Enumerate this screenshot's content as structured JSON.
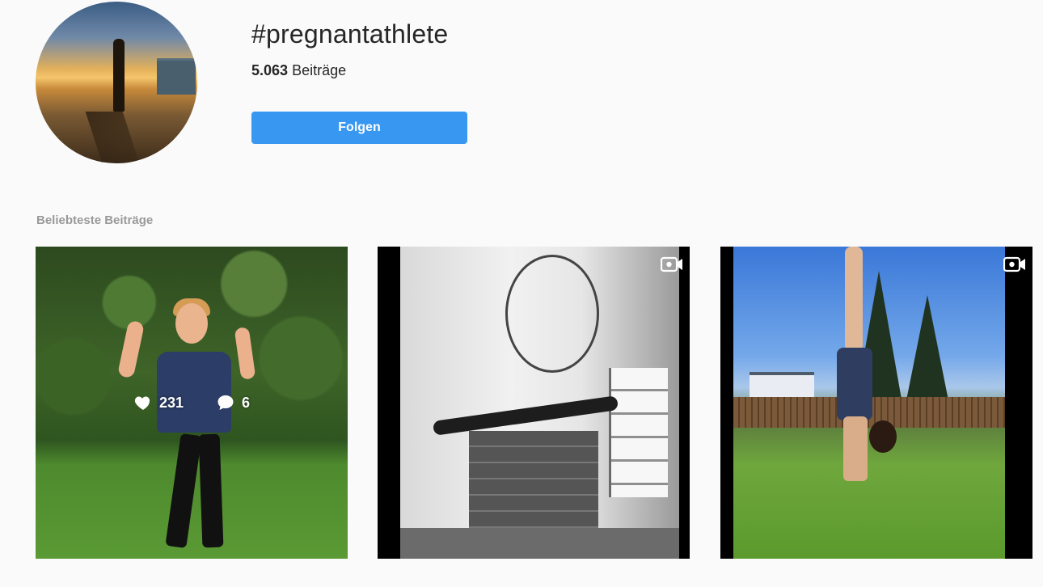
{
  "header": {
    "hashtag": "#pregnantathlete",
    "post_count_number": "5.063",
    "post_count_label": "Beiträge",
    "follow_button": "Folgen"
  },
  "top_posts": {
    "section_label": "Beliebteste Beiträge",
    "posts": [
      {
        "likes": "231",
        "comments": "6",
        "is_video": false,
        "hovered": true
      },
      {
        "is_video": true
      },
      {
        "is_video": true
      }
    ]
  },
  "colors": {
    "background": "#fafafa",
    "follow_button": "#3897f0",
    "section_label": "#999999",
    "text": "#262626"
  },
  "icons": {
    "likes": "heart-icon",
    "comments": "comment-bubble-icon",
    "video": "video-camera-icon"
  }
}
